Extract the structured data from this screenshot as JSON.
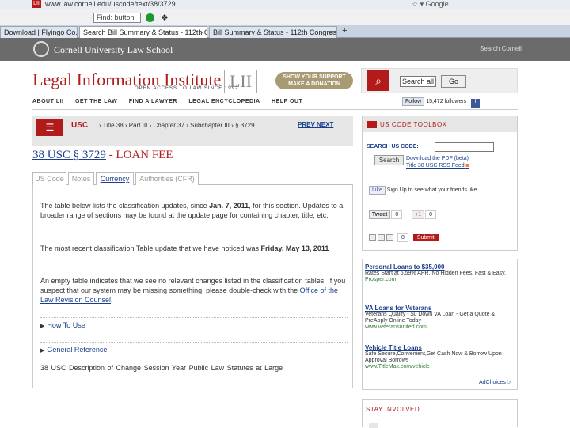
{
  "browser": {
    "url": "www.law.cornell.edu/uscode/text/38/3729",
    "find_label": "Find: button",
    "google": "Google",
    "tabs": [
      {
        "label": "Download | Flyingo Co..."
      },
      {
        "label": "Search Bill Summary & Status - 112th Co..."
      },
      {
        "label": "Bill Summary & Status - 112th Congress (..."
      }
    ],
    "new_tab": "+"
  },
  "header": {
    "school": "Cornell University Law School",
    "search_label": "Search Cornell"
  },
  "lii": {
    "title": "Legal Information Institute",
    "tagline": "OPEN ACCESS TO LAW SINCE 1992",
    "mark": "LII",
    "donate": "SHOW YOUR SUPPORT MAKE A DONATION",
    "search_value": "Search all of LII",
    "go": "Go"
  },
  "nav": [
    "ABOUT LII",
    "GET THE LAW",
    "FIND A LAWYER",
    "LEGAL ENCYCLOPEDIA",
    "HELP OUT"
  ],
  "social": {
    "follow": "Follow",
    "followers": "15,472 followers",
    "fb": "f"
  },
  "crumb": {
    "usc": "USC",
    "path": "› Title 38 › Part III › Chapter 37 › Subchapter III › § 3729",
    "prevnext": "PREV NEXT"
  },
  "page": {
    "title_link": "38 USC § 3729",
    "title_rest": " - LOAN FEE",
    "tabs": [
      "US Code",
      "Notes",
      "Currency",
      "Authorities (CFR)"
    ]
  },
  "currency": {
    "p1_a": "The table below lists the classification updates, since ",
    "p1_b": "Jan. 7, 2011",
    "p1_c": ", for this section. Updates to a broader range of sections may be found at the update page for containing chapter, title, etc.",
    "p2_a": "The most recent classification Table update that we have noticed was ",
    "p2_b": "Friday, May 13, 2011",
    "p3_a": "An empty table indicates that we see no relevant changes listed in the classification tables. If you suspect that our system may be missing something, please double-check with the ",
    "p3_link": "Office of the Law Revision Counsel",
    "p3_c": ".",
    "how_to": "How To Use",
    "general": "General Reference",
    "columns": "38 USC Description of Change    Session Year    Public Law    Statutes at Large"
  },
  "sidebox": {
    "title": "US CODE TOOLBOX",
    "search_label": "SEARCH US CODE:",
    "search_btn": "Search",
    "pdf_link": "Download the PDF (beta)",
    "rss": "Title 38 USC RSS Feed",
    "like": "Like",
    "fb_text": "Sign Up to see what your friends like.",
    "tweet": "Tweet",
    "tweet_count": "0",
    "plus_count": "0",
    "share_count": "0",
    "submit": "Submit"
  },
  "ads": [
    {
      "h": "Personal Loans to $35,000",
      "d": "Rates Start at 6.59% APR. No Hidden Fees. Fast & Easy.",
      "u": "Prosper.com"
    },
    {
      "h": "VA Loans for Veterans",
      "d": "Veterans Qualify - $0 Down VA Loan - Get a Quote & PreApply Online Today",
      "u": "www.veteransunited.com"
    },
    {
      "h": "Vehicle Title Loans",
      "d": "Safe Secure,Convenient,Get Cash Now & Borrow Upon Approval Borrows",
      "u": "www.TitleMax.com/vehicle"
    }
  ],
  "adchoices": "AdChoices ▷",
  "stay": "STAY INVOLVED",
  "colors": {
    "brand": "#b31b1b",
    "link": "#1a3e8b",
    "header_bg": "#6b6b6b"
  }
}
